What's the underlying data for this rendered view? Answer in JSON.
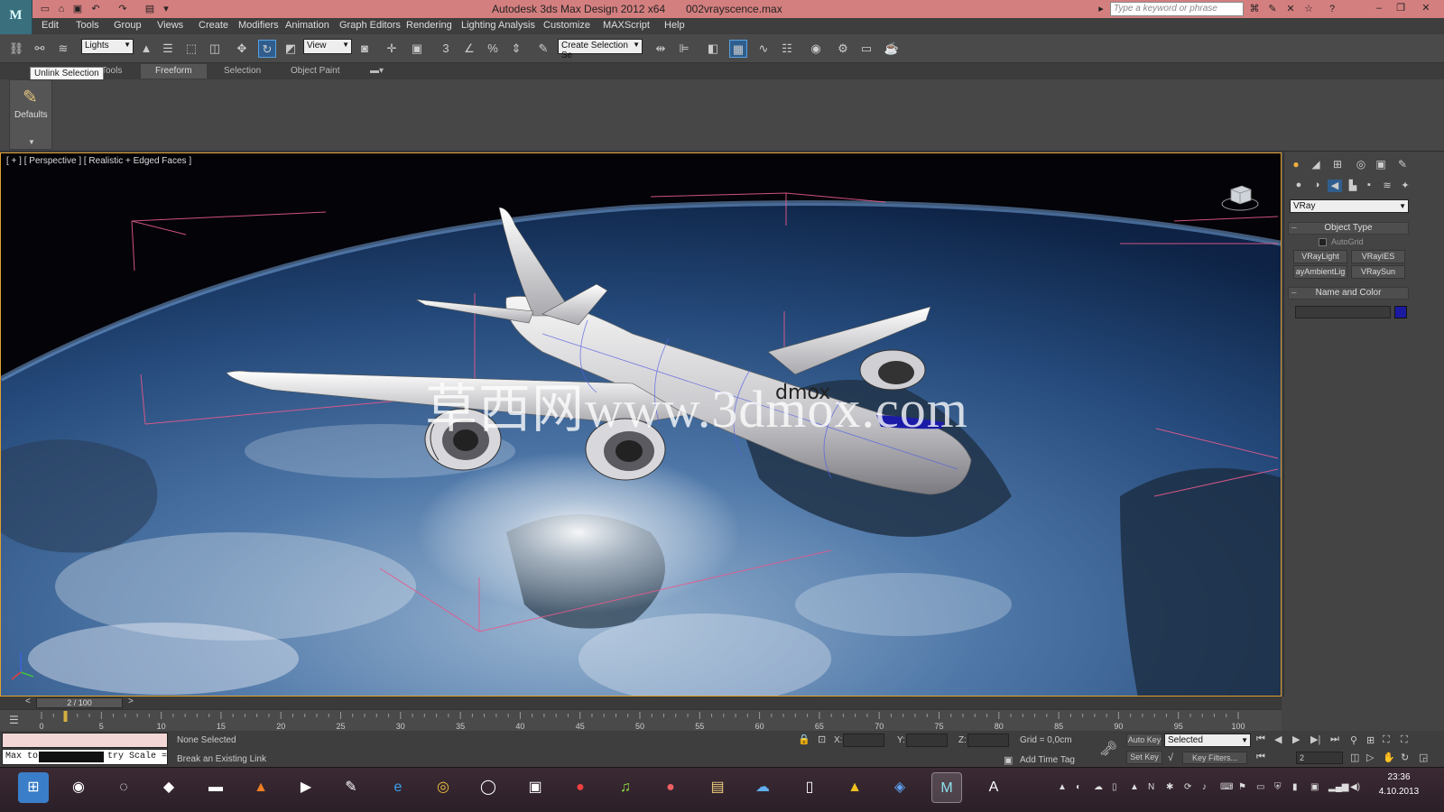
{
  "titlebar": {
    "app_title": "Autodesk 3ds Max Design 2012 x64",
    "file_name": "002vrayscence.max",
    "search_placeholder": "Type a keyword or phrase",
    "logo_text": "M",
    "colors": {
      "titlebar": "#d47f7f"
    }
  },
  "menu": {
    "items": [
      "Edit",
      "Tools",
      "Group",
      "Views",
      "Create",
      "Modifiers",
      "Animation",
      "Graph Editors",
      "Rendering",
      "Lighting Analysis",
      "Customize",
      "MAXScript",
      "Help"
    ]
  },
  "toolbar": {
    "selection_filter": "Lights",
    "reference_coord": "View",
    "named_selection_placeholder": "Create Selection Se",
    "snap_label": "3",
    "angle_label": "%",
    "icons": [
      "link-icon",
      "unlink-icon",
      "bind-spacewarp-icon",
      "select-object-icon",
      "select-by-name-icon",
      "rect-region-icon",
      "window-crossing-icon",
      "move-icon",
      "rotate-icon",
      "scale-icon",
      "pivot-icon",
      "manipulate-icon",
      "snap-icon",
      "angle-snap-icon",
      "percent-snap-icon",
      "spinner-snap-icon",
      "edit-named-sel-icon",
      "mirror-icon",
      "align-icon",
      "layer-icon",
      "graphite-icon",
      "curve-editor-icon",
      "schematic-icon",
      "material-editor-icon",
      "render-setup-icon",
      "render-frame-icon",
      "render-icon"
    ]
  },
  "ribbon": {
    "tooltip": "Unlink Selection",
    "tabs": [
      "Tools",
      "Freeform",
      "Selection",
      "Object Paint"
    ],
    "active_tab": "Freeform",
    "defaults_label": "Defaults"
  },
  "viewport": {
    "label": "[ + ] [ Perspective ] [ Realistic + Edged Faces ]",
    "watermark": "草西网www.3dmox.com",
    "fuselage_text": "dmox"
  },
  "command_panel": {
    "renderer": "VRay",
    "object_type_title": "Object Type",
    "autogrid_label": "AutoGrid",
    "object_buttons": [
      "VRayLight",
      "VRayIES",
      "ayAmbientLig",
      "VRaySun"
    ],
    "name_color_title": "Name and Color",
    "swatch_color": "#1a1aa0"
  },
  "timeline": {
    "frame_display": "2 / 100",
    "current_frame": 2,
    "ticks": [
      0,
      5,
      10,
      15,
      20,
      25,
      30,
      35,
      40,
      45,
      50,
      55,
      60,
      65,
      70,
      75,
      80,
      85,
      90,
      95,
      100
    ]
  },
  "status": {
    "maxscript_text_a": "Max to",
    "maxscript_text_b": "try Scale =",
    "selection_status": "None Selected",
    "prompt": "Break an Existing Link",
    "x_label": "X:",
    "y_label": "Y:",
    "z_label": "Z:",
    "grid": "Grid = 0,0cm",
    "add_time_tag": "Add Time Tag",
    "auto_key": "Auto Key",
    "set_key": "Set Key",
    "key_mode": "Selected",
    "key_filters": "Key Filters...",
    "current_frame_field": "2"
  },
  "taskbar": {
    "time": "23:36",
    "date": "4.10.2013"
  }
}
